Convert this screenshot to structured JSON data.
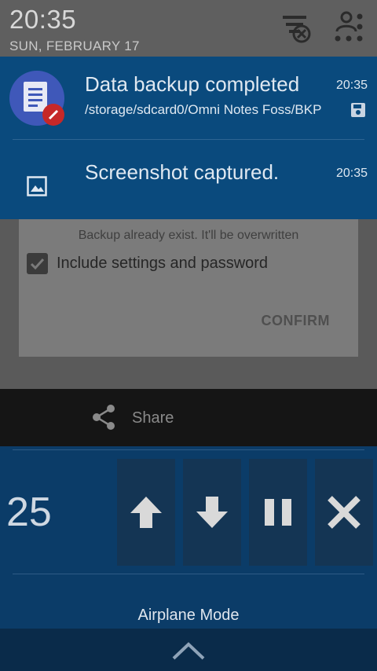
{
  "status": {
    "time": "20:35",
    "date": "SUN, FEBRUARY 17"
  },
  "notifications": [
    {
      "title": "Data backup completed",
      "text": "/storage/sdcard0/Omni Notes Foss/BKP",
      "time": "20:35",
      "icon": "omni-notes-app-icon",
      "action_icon": "save-icon"
    },
    {
      "title": "Screenshot captured.",
      "time": "20:35",
      "icon": "image-icon"
    }
  ],
  "dialog": {
    "message": "Backup already exist. It'll be overwritten",
    "checkbox_label": "Include settings and password",
    "checkbox_checked": true,
    "confirm_label": "CONFIRM"
  },
  "share": {
    "label": "Share",
    "icon": "share-icon"
  },
  "quick_controls": {
    "value": "25",
    "buttons": [
      "arrow-up-icon",
      "arrow-down-icon",
      "pause-icon",
      "close-icon"
    ],
    "label": "Airplane Mode"
  },
  "colors": {
    "notification_bg": "#0a4a7d",
    "quick_panel_bg": "#0b3c68",
    "accent_red": "#c62828",
    "app_icon_blue": "#3f58b9"
  }
}
